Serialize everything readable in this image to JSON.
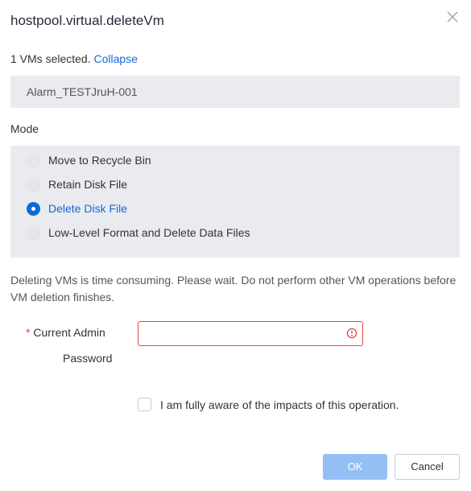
{
  "dialog": {
    "title": "hostpool.virtual.deleteVm",
    "close_icon": "close-icon"
  },
  "selection": {
    "count_text": "1 VMs selected.",
    "collapse_label": "Collapse",
    "vm_names": [
      "Alarm_TESTJruH-001"
    ]
  },
  "mode": {
    "label": "Mode",
    "options": [
      {
        "label": "Move to Recycle Bin",
        "checked": false
      },
      {
        "label": "Retain Disk File",
        "checked": false
      },
      {
        "label": "Delete Disk File",
        "checked": true
      },
      {
        "label": "Low-Level Format and Delete Data Files",
        "checked": false
      }
    ]
  },
  "warning_text": "Deleting VMs is time consuming. Please wait. Do not perform other VM operations before VM deletion finishes.",
  "password": {
    "required_mark": "*",
    "label_line1": "Current Admin",
    "label_line2": "Password",
    "value": "",
    "error_icon": "error-circle-icon"
  },
  "confirm": {
    "label": "I am fully aware of the impacts of this operation.",
    "checked": false
  },
  "buttons": {
    "ok_label": "OK",
    "cancel_label": "Cancel"
  },
  "colors": {
    "accent": "#0d6ad9",
    "error": "#e54545",
    "panel_bg": "#e9ebef",
    "ok_disabled": "#93bff2"
  }
}
